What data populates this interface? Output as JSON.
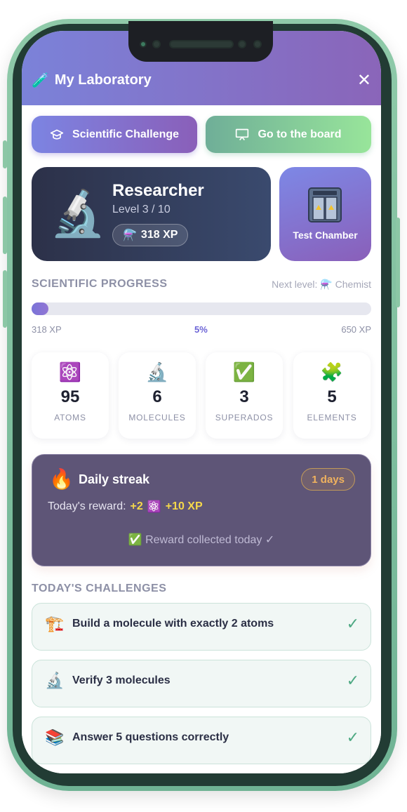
{
  "header": {
    "title": "My Laboratory",
    "title_icon": "test-tube-icon",
    "close_label": "✕"
  },
  "actions": {
    "challenge_label": "Scientific Challenge",
    "board_label": "Go to the board"
  },
  "profile": {
    "icon": "🔬",
    "rank": "Researcher",
    "level": "Level 3 / 10",
    "xp_icon": "⚗️",
    "xp": "318 XP"
  },
  "chamber": {
    "label": "Test Chamber"
  },
  "progress": {
    "section_title": "SCIENTIFIC PROGRESS",
    "next_level": "Next level: ⚗️ Chemist",
    "current": "318 XP",
    "percent_label": "5%",
    "percent": 5,
    "target": "650 XP"
  },
  "stats": [
    {
      "icon": "⚛️",
      "value": "95",
      "label": "ATOMS"
    },
    {
      "icon": "🔬",
      "value": "6",
      "label": "MOLECULES"
    },
    {
      "icon": "✅",
      "value": "3",
      "label": "SUPERADOS"
    },
    {
      "icon": "🧩",
      "value": "5",
      "label": "ELEMENTS"
    }
  ],
  "streak": {
    "icon": "🔥",
    "title": "Daily streak",
    "days": "1 days",
    "reward_prefix": "Today's reward:",
    "reward_atoms": "+2",
    "reward_atom_icon": "⚛️",
    "reward_xp": "+10 XP",
    "collected": "✅ Reward collected today ✓"
  },
  "challenges": {
    "section_title": "TODAY'S CHALLENGES",
    "items": [
      {
        "icon": "🏗️",
        "text": "Build a molecule with exactly 2 atoms",
        "check": "✓"
      },
      {
        "icon": "🔬",
        "text": "Verify 3 molecules",
        "check": "✓"
      },
      {
        "icon": "📚",
        "text": "Answer 5 questions correctly",
        "check": "✓"
      }
    ]
  },
  "colors": {
    "accent": "#7b82d9",
    "accent2": "#8a65b9",
    "green": "#98e59a",
    "streak_bg": "#5e5577"
  }
}
